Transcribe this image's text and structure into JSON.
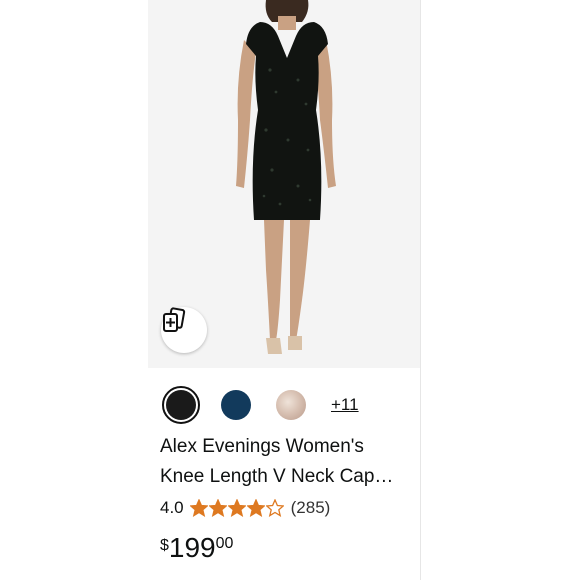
{
  "product": {
    "image_alt": "Black sequin V-neck cap sleeve knee length dress",
    "compare_icon": "compare-icon",
    "swatches": [
      {
        "name": "black",
        "color": "#1a1a1a",
        "selected": true
      },
      {
        "name": "navy",
        "color": "#123a5c",
        "selected": false
      },
      {
        "name": "blush",
        "color": "#d8c1b3",
        "selected": false
      }
    ],
    "more_colors": "+11",
    "title": "Alex Evenings Women's Knee Length V Neck Cap Sleeve Sequin Dress",
    "rating": {
      "value": "4.0",
      "stars": 4,
      "max": 5,
      "count": "(285)",
      "star_color": "#de7921"
    },
    "price": {
      "symbol": "$",
      "whole": "199",
      "fraction": "00"
    }
  }
}
